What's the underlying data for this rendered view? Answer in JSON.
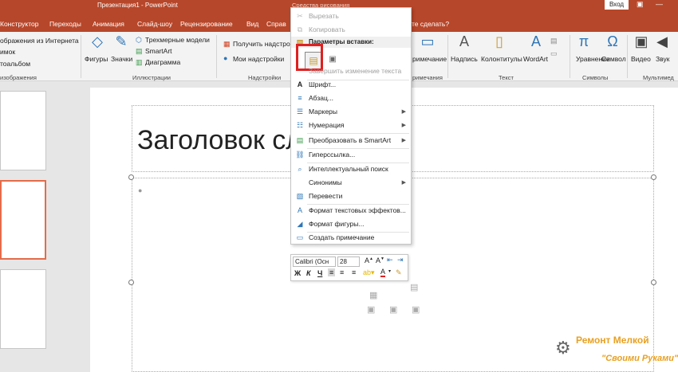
{
  "titlebar": {
    "title": "Презентация1 - PowerPoint",
    "context_tab": "Средства рисования",
    "login": "Вход",
    "tell_me": "те сделать?"
  },
  "tabs": [
    "Конструктор",
    "Переходы",
    "Анимация",
    "Слайд-шоу",
    "Рецензирование",
    "Вид",
    "Справ"
  ],
  "ribbon": {
    "images": {
      "item1": "ображения из Интернета",
      "item2": "имок",
      "item3": "тоальбом",
      "label": "изображения"
    },
    "illustrations": {
      "shapes": "Фигуры",
      "icons": "Значки",
      "models": "Трехмерные модели",
      "smartart": "SmartArt",
      "chart": "Диаграмма",
      "label": "Иллюстрации"
    },
    "addins": {
      "get": "Получить надстро",
      "my": "Мои надстройки",
      "label": "Надстройки"
    },
    "comments": {
      "comment": "римечание",
      "label": "римечания"
    },
    "text": {
      "label_btn": "Надпись",
      "header": "Колонтитулы",
      "wordart": "WordArt",
      "label": "Текст"
    },
    "symbols": {
      "equation": "Уравнение",
      "symbol": "Символ",
      "label": "Символы"
    },
    "media": {
      "video": "Видео",
      "audio": "Звук",
      "label": "Мультимед"
    }
  },
  "slide": {
    "title": "Заголовок сла"
  },
  "context_menu": {
    "cut": "Вырезать",
    "copy": "Копировать",
    "paste_header": "Параметры вставки:",
    "finish_edit": "Завершить изменение текста",
    "font": "Шрифт...",
    "paragraph": "Абзац...",
    "bullets": "Маркеры",
    "numbering": "Нумерация",
    "smartart": "Преобразовать в SmartArt",
    "hyperlink": "Гиперссылка...",
    "smart_search": "Интеллектуальный поиск",
    "synonyms": "Синонимы",
    "translate": "Перевести",
    "text_effects": "Формат текстовых эффектов...",
    "shape_format": "Формат фигуры...",
    "new_comment": "Создать примечание"
  },
  "mini_toolbar": {
    "font": "Calibri (Осн",
    "size": "28",
    "bold": "Ж",
    "italic": "К",
    "underline": "Ч"
  },
  "watermark": {
    "line1": "Ремонт Мелкой",
    "line2": "\"Своими Руками\""
  },
  "colors": {
    "accent": "#b7472a",
    "highlight": "#e02020",
    "blue": "#2e75b6"
  }
}
